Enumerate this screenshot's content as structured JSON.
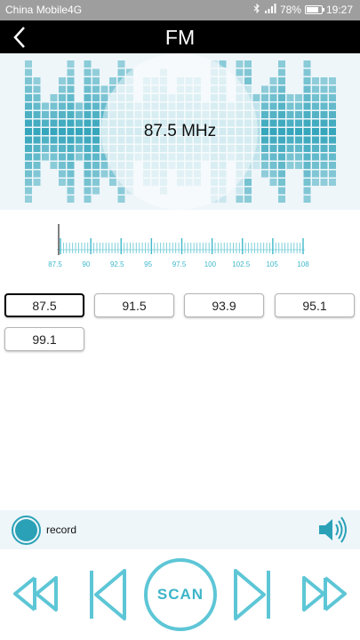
{
  "status_bar": {
    "carrier": "China Mobile4G",
    "battery": "78%",
    "time": "19:27",
    "icons": [
      "bluetooth-icon",
      "signal-icon",
      "battery-icon"
    ]
  },
  "header": {
    "title": "FM",
    "back_icon": "back-arrow-icon"
  },
  "display": {
    "frequency": "87.5 MHz"
  },
  "tuner": {
    "tick_labels": [
      "87.5",
      "90",
      "92.5",
      "95",
      "97.5",
      "100",
      "102.5",
      "105",
      "108"
    ],
    "current_value": 87.5,
    "min": 87.5,
    "max": 108
  },
  "presets": [
    "87.5",
    "91.5",
    "93.9",
    "95.1",
    "99.1"
  ],
  "selected_preset": "87.5",
  "record": {
    "label": "record"
  },
  "controls": {
    "scan_label": "SCAN",
    "icons": [
      "fast-backward-icon",
      "previous-icon",
      "next-icon",
      "fast-forward-icon",
      "speaker-icon"
    ]
  },
  "colors": {
    "accent": "#2aa1b7",
    "accent_light": "#5dc6d6",
    "status_bar": "#9e9e9e",
    "header": "#000000",
    "panel": "#eef6fa"
  }
}
